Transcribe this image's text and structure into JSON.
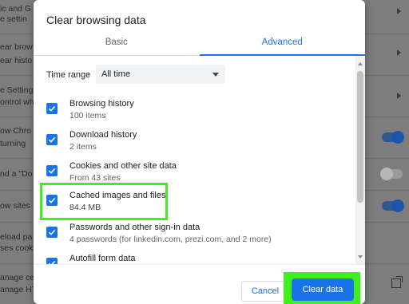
{
  "background": {
    "items": [
      "ic and G",
      "e settin",
      "ear brow",
      "ear histo",
      "e Setting",
      "ontrol wh",
      "ow Chro",
      "turning",
      "nd a \"Do",
      "ow sites",
      "eload pa",
      "ses cook",
      "anage ce",
      "anage HT"
    ]
  },
  "dialog": {
    "title": "Clear browsing data",
    "tabs": [
      {
        "label": "Basic",
        "active": false
      },
      {
        "label": "Advanced",
        "active": true
      }
    ],
    "time_range": {
      "label": "Time range",
      "value": "All time"
    },
    "items": [
      {
        "title": "Browsing history",
        "subtitle": "100 items",
        "checked": true
      },
      {
        "title": "Download history",
        "subtitle": "2 items",
        "checked": true
      },
      {
        "title": "Cookies and other site data",
        "subtitle": "From 43 sites",
        "checked": true
      },
      {
        "title": "Cached images and files",
        "subtitle": "84.4 MB",
        "checked": true,
        "highlighted": true
      },
      {
        "title": "Passwords and other sign-in data",
        "subtitle": "4 passwords (for linkedin.com, prezi.com, and 2 more)",
        "checked": true
      },
      {
        "title": "Autofill form data",
        "subtitle": "",
        "checked": true
      }
    ],
    "buttons": {
      "cancel": "Cancel",
      "clear": "Clear data"
    }
  },
  "colors": {
    "accent": "#1a73e8",
    "highlight": "#3ff01a"
  }
}
